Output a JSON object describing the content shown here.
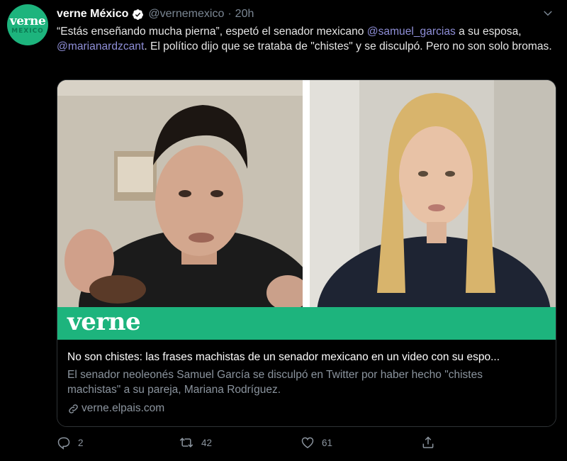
{
  "tweet": {
    "avatar": {
      "top": "verne",
      "bottom": "MEXICO"
    },
    "author_name": "verne México",
    "handle": "@vernemexico",
    "separator": "·",
    "time": "20h",
    "text": {
      "p1": "“Estás enseñando mucha pierna”, espetó el senador mexicano ",
      "m1": "@samuel_garcias",
      "p2": " a su esposa, ",
      "m2": "@marianardzcant",
      "p3": ". El político dijo que se trataba de \"chistes\" y se disculpó. Pero no son solo bromas."
    },
    "card": {
      "brand": "verne",
      "title": "No son chistes: las frases machistas de un senador mexicano en un video con su espo...",
      "description": "El senador neoleonés Samuel García se disculpó en Twitter por haber hecho \"chistes machistas\" a su pareja, Mariana Rodríguez.",
      "link": "verne.elpais.com"
    },
    "actions": {
      "replies": "2",
      "retweets": "42",
      "likes": "61"
    }
  },
  "colors": {
    "background": "#000000",
    "brand_green": "#1db47d",
    "mention": "#8f8fd8",
    "secondary_text": "#8b949e"
  },
  "icons": [
    "verified-badge-icon",
    "chevron-down-icon",
    "reply-icon",
    "retweet-icon",
    "like-icon",
    "share-icon",
    "link-icon"
  ]
}
